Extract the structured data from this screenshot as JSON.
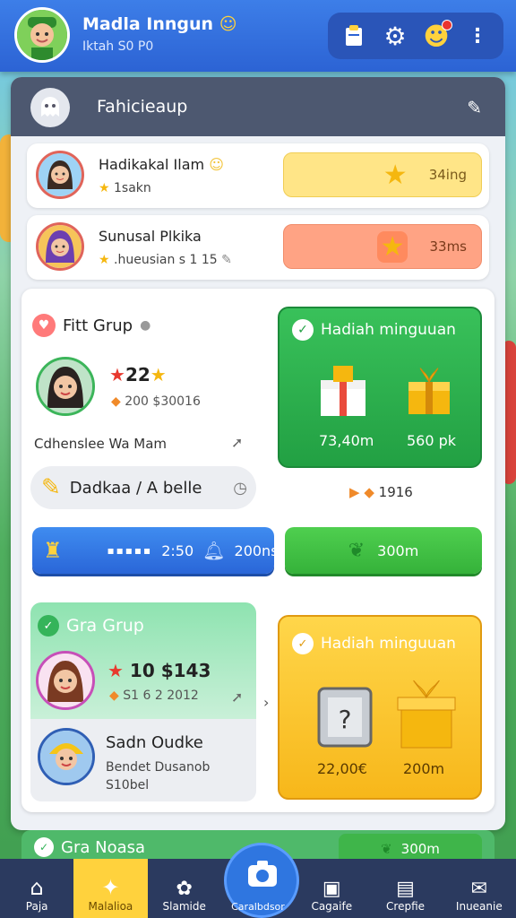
{
  "header": {
    "user_name": "Madla Inngun",
    "user_sub": "Iktah S0 P0"
  },
  "panel": {
    "title": "Fahicieaup"
  },
  "rows": [
    {
      "name": "Hadikakal Ilam",
      "sub": "1sakn",
      "badge": "34ing"
    },
    {
      "name": "Sunusal Plkika",
      "sub": ".hueusian s 1 15",
      "badge": "33ms"
    }
  ],
  "group1": {
    "title": "Fitt Grup",
    "stars": "22",
    "stat": "200 $30016",
    "desc": "Cdhenslee Wa Mam",
    "pill": "Dadkaa / A belle",
    "reward_title": "Hadiah minguuan",
    "reward_values": [
      "73,40m",
      "560 pk"
    ],
    "reward_footer": "1916",
    "blue_btn_mid": "2:50",
    "blue_btn_value": "200ns",
    "green_btn_value": "300m"
  },
  "group2": {
    "title": "Gra Grup",
    "stars": "10 $143",
    "stat": "S1 6 2 2012",
    "member_name": "Sadn Oudke",
    "member_sub1": "Bendet Dusanob",
    "member_sub2": "S10bel",
    "reward_title": "Hadiah minguuan",
    "reward_values": [
      "22,00€",
      "200m"
    ]
  },
  "bottom": {
    "strip_title": "Gra Noasa",
    "strip_value": "300m"
  },
  "nav": [
    {
      "label": "Paja"
    },
    {
      "label": "Malalioa"
    },
    {
      "label": "Slamide"
    },
    {
      "label": "Caralbdsor"
    },
    {
      "label": "Cagaife"
    },
    {
      "label": "Crepfie"
    },
    {
      "label": "Inueanie"
    }
  ]
}
